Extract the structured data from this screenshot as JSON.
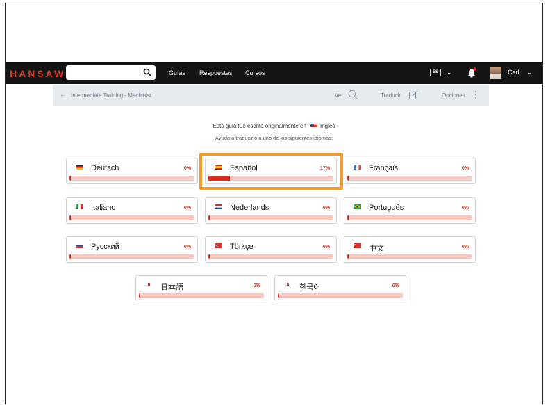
{
  "logo": "HANSAW",
  "search": {
    "value": ""
  },
  "nav": [
    "Guías",
    "Respuestas",
    "Cursos"
  ],
  "language_badge": "ES",
  "user": {
    "name": "Carl"
  },
  "colors": {
    "brand": "#d63a2a",
    "accent_highlight": "#f39a2c",
    "navbar": "#141414",
    "progress_track": "#f6c9c3",
    "progress_fill": "#e02b1c"
  },
  "breadcrumb": {
    "text": "Intermediate Training - Machinist",
    "ver": "Ver",
    "traducir": "Traducir",
    "opciones": "Opciones"
  },
  "intro": {
    "line1": "Esta guía fue escrita originalmente en",
    "original_language": "Inglés",
    "line2": "Ayuda a traducirlo a uno de los siguientes idiomas:"
  },
  "languages": [
    {
      "name": "Deutsch",
      "percent": "0%",
      "progress": 0.0,
      "flag": "de"
    },
    {
      "name": "Español",
      "percent": "17%",
      "progress": 0.17,
      "flag": "es",
      "highlighted": true
    },
    {
      "name": "Français",
      "percent": "0%",
      "progress": 0.0,
      "flag": "fr"
    },
    {
      "name": "Italiano",
      "percent": "0%",
      "progress": 0.0,
      "flag": "it"
    },
    {
      "name": "Nederlands",
      "percent": "0%",
      "progress": 0.0,
      "flag": "nl"
    },
    {
      "name": "Português",
      "percent": "0%",
      "progress": 0.0,
      "flag": "br"
    },
    {
      "name": "Русский",
      "percent": "0%",
      "progress": 0.0,
      "flag": "ru"
    },
    {
      "name": "Türkçe",
      "percent": "0%",
      "progress": 0.0,
      "flag": "tr"
    },
    {
      "name": "中文",
      "percent": "0%",
      "progress": 0.0,
      "flag": "cn"
    },
    {
      "name": "日本語",
      "percent": "0%",
      "progress": 0.0,
      "flag": "jp"
    },
    {
      "name": "한국어",
      "percent": "0%",
      "progress": 0.0,
      "flag": "kr"
    }
  ]
}
